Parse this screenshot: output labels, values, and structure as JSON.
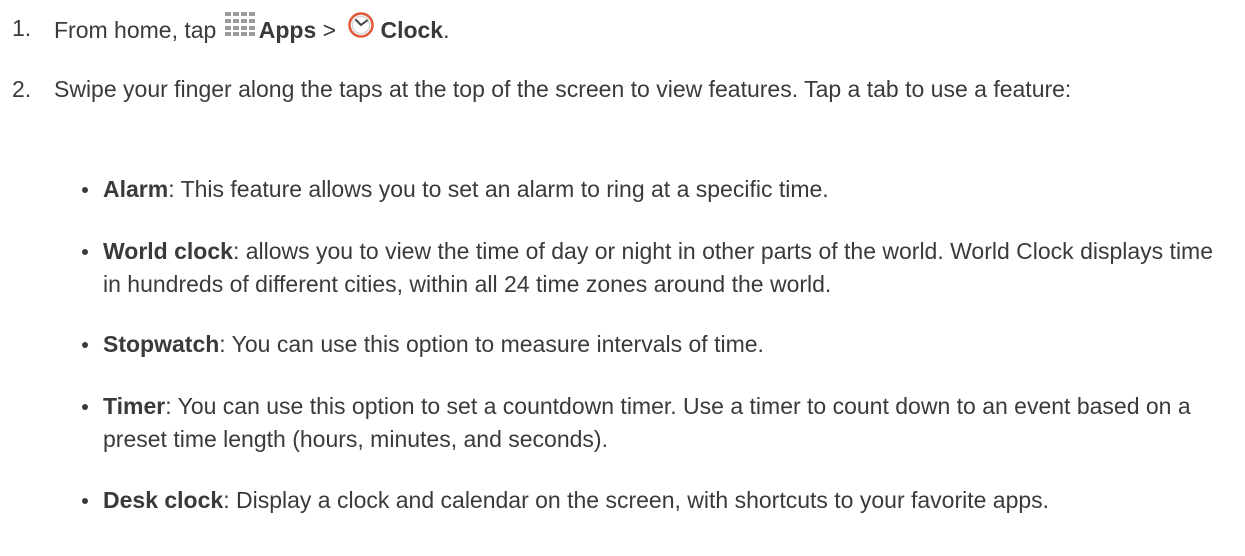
{
  "steps": [
    {
      "number": "1.",
      "prefix": "From home, tap ",
      "apps_label": "Apps",
      "separator": " > ",
      "clock_label": "Clock",
      "suffix": "."
    },
    {
      "number": "2.",
      "text": "Swipe your finger along the taps at the top of the screen to view features. Tap a tab to use a feature:"
    }
  ],
  "features": [
    {
      "name": "Alarm",
      "description": ": This feature allows you to set an alarm to ring at a specific time."
    },
    {
      "name": "World clock",
      "description": ": allows you to view the time of day or night in other parts of the world. World Clock displays time in hundreds of different cities, within all 24 time zones around the world."
    },
    {
      "name": "Stopwatch",
      "description": ": You can use this option to measure intervals of time."
    },
    {
      "name": "Timer",
      "description": ": You can use this option to set a countdown timer. Use a timer to count down to an event based on a preset time length (hours, minutes, and seconds)."
    },
    {
      "name": "Desk clock",
      "description": ": Display a clock and calendar on the screen, with shortcuts to your favorite apps."
    }
  ],
  "icons": {
    "apps": "apps-grid-icon",
    "clock": "clock-icon"
  },
  "colors": {
    "text": "#3a3a3a",
    "apps_icon": "#9a9a9a",
    "clock_ring": "#e05a3a"
  }
}
